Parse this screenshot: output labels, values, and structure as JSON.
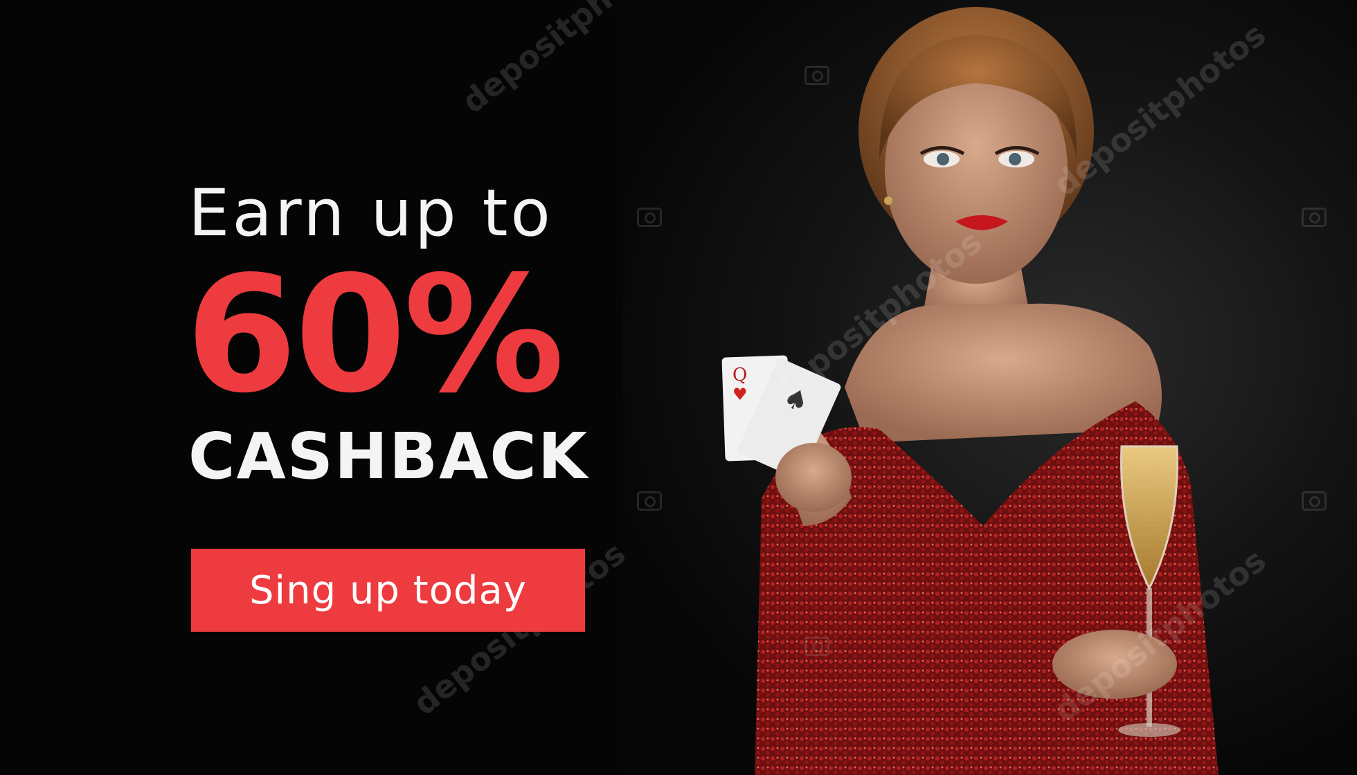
{
  "banner": {
    "headline_line1": "Earn up to",
    "headline_big": "60%",
    "headline_line3": "CASHBACK",
    "cta_label": "Sing up today"
  },
  "watermark": {
    "text": "depositphotos"
  },
  "colors": {
    "accent": "#ee3b3f",
    "text": "#f4f4f4",
    "background": "#050505"
  }
}
